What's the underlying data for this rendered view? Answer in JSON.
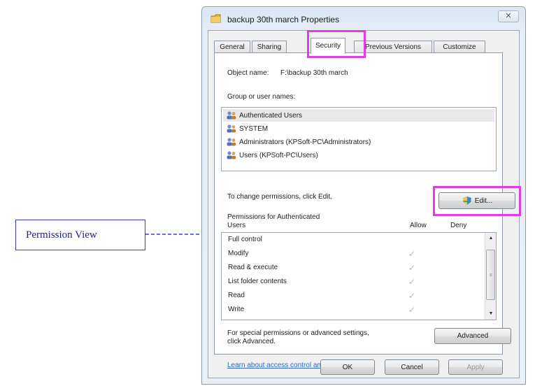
{
  "callout": {
    "label": "Permission View"
  },
  "window": {
    "title": "backup 30th march Properties",
    "close_glyph": "✕"
  },
  "tabs": [
    {
      "label": "General"
    },
    {
      "label": "Sharing"
    },
    {
      "label": "Security"
    },
    {
      "label": "Previous Versions"
    },
    {
      "label": "Customize"
    }
  ],
  "security": {
    "object_name_label": "Object name:",
    "object_name_value": "F:\\backup 30th march",
    "group_label": "Group or user names:",
    "users": [
      {
        "name": "Authenticated Users"
      },
      {
        "name": "SYSTEM"
      },
      {
        "name": "Administrators (KPSoft-PC\\Administrators)"
      },
      {
        "name": "Users (KPSoft-PC\\Users)"
      }
    ],
    "change_hint": "To change permissions, click Edit.",
    "edit_button": "Edit...",
    "permissions_for_line1": "Permissions for Authenticated",
    "permissions_for_line2": "Users",
    "allow_header": "Allow",
    "deny_header": "Deny",
    "check_glyph": "✓",
    "permissions": [
      {
        "name": "Full control",
        "allow": false,
        "deny": false
      },
      {
        "name": "Modify",
        "allow": true,
        "deny": false
      },
      {
        "name": "Read & execute",
        "allow": true,
        "deny": false
      },
      {
        "name": "List folder contents",
        "allow": true,
        "deny": false
      },
      {
        "name": "Read",
        "allow": true,
        "deny": false
      },
      {
        "name": "Write",
        "allow": true,
        "deny": false
      }
    ],
    "advanced_hint_line1": "For special permissions or advanced settings,",
    "advanced_hint_line2": "click Advanced.",
    "advanced_button": "Advanced",
    "learn_link": "Learn about access control and permissions"
  },
  "footer": {
    "ok": "OK",
    "cancel": "Cancel",
    "apply": "Apply"
  },
  "colors": {
    "highlight": "#e23ce2",
    "callout_border": "#3a3ad8",
    "link": "#2e6bd6"
  }
}
